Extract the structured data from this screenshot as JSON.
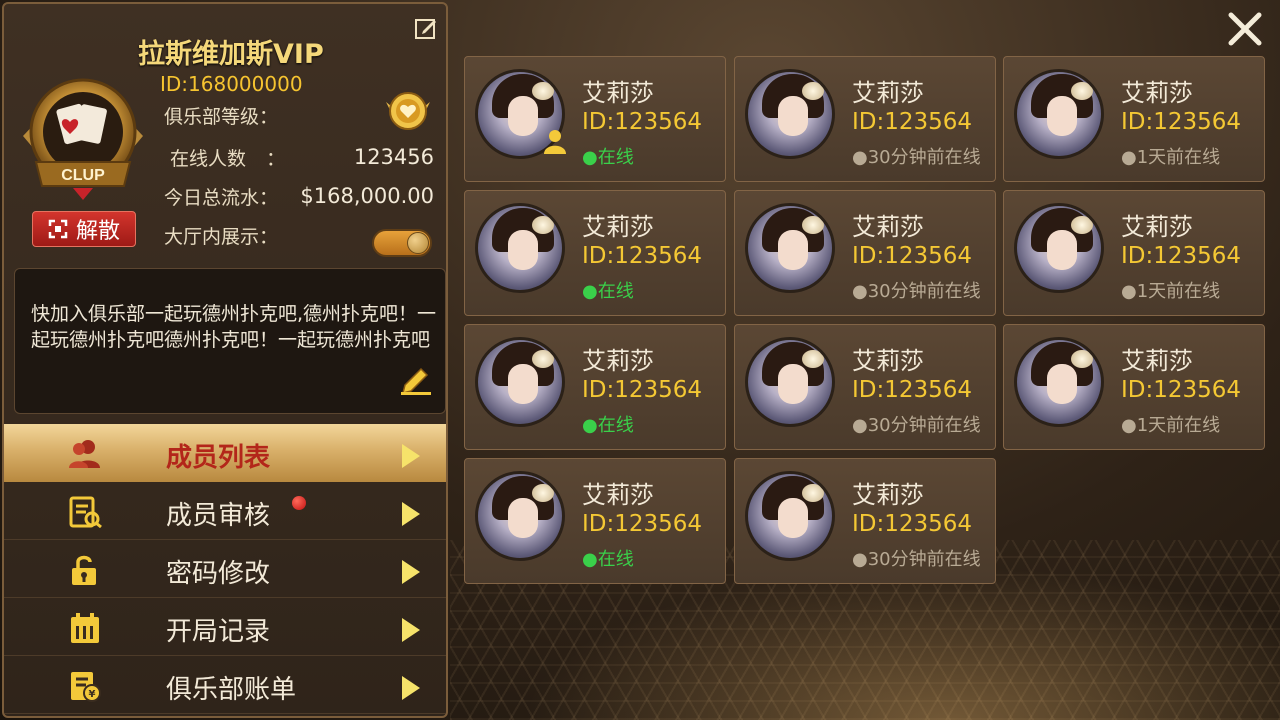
{
  "club": {
    "name": "拉斯维加斯VIP",
    "id": "ID:168000000",
    "level_label": "俱乐部等级：",
    "online_label": "在线人数",
    "online_colon": "：",
    "online_count": "123456",
    "flow_label": "今日总流水：",
    "flow_value": "$168,000.00",
    "show_label": "大厅内展示：",
    "show_enabled": true,
    "dissolve_label": "解散",
    "notice": "快加入俱乐部一起玩德州扑克吧,德州扑克吧！一起玩德州扑克吧德州扑克吧！一起玩德州扑克吧",
    "logo_text": "CLUP"
  },
  "menu": [
    {
      "label": "成员列表",
      "icon": "members-icon",
      "active": true
    },
    {
      "label": "成员审核",
      "icon": "review-icon",
      "badge": true
    },
    {
      "label": "密码修改",
      "icon": "lock-icon"
    },
    {
      "label": "开局记录",
      "icon": "calendar-icon"
    },
    {
      "label": "俱乐部账单",
      "icon": "bill-icon"
    }
  ],
  "members": [
    {
      "name": "艾莉莎",
      "id": "ID:123564",
      "status": "●在线",
      "online": true,
      "owner": true
    },
    {
      "name": "艾莉莎",
      "id": "ID:123564",
      "status": "●30分钟前在线",
      "online": false
    },
    {
      "name": "艾莉莎",
      "id": "ID:123564",
      "status": "●1天前在线",
      "online": false
    },
    {
      "name": "艾莉莎",
      "id": "ID:123564",
      "status": "●在线",
      "online": true
    },
    {
      "name": "艾莉莎",
      "id": "ID:123564",
      "status": "●30分钟前在线",
      "online": false
    },
    {
      "name": "艾莉莎",
      "id": "ID:123564",
      "status": "●1天前在线",
      "online": false
    },
    {
      "name": "艾莉莎",
      "id": "ID:123564",
      "status": "●在线",
      "online": true
    },
    {
      "name": "艾莉莎",
      "id": "ID:123564",
      "status": "●30分钟前在线",
      "online": false
    },
    {
      "name": "艾莉莎",
      "id": "ID:123564",
      "status": "●1天前在线",
      "online": false
    },
    {
      "name": "艾莉莎",
      "id": "ID:123564",
      "status": "●在线",
      "online": true
    },
    {
      "name": "艾莉莎",
      "id": "ID:123564",
      "status": "●30分钟前在线",
      "online": false
    }
  ],
  "colors": {
    "accent_gold": "#f6c430",
    "online_green": "#3ad04a",
    "danger_red": "#b3261a"
  }
}
